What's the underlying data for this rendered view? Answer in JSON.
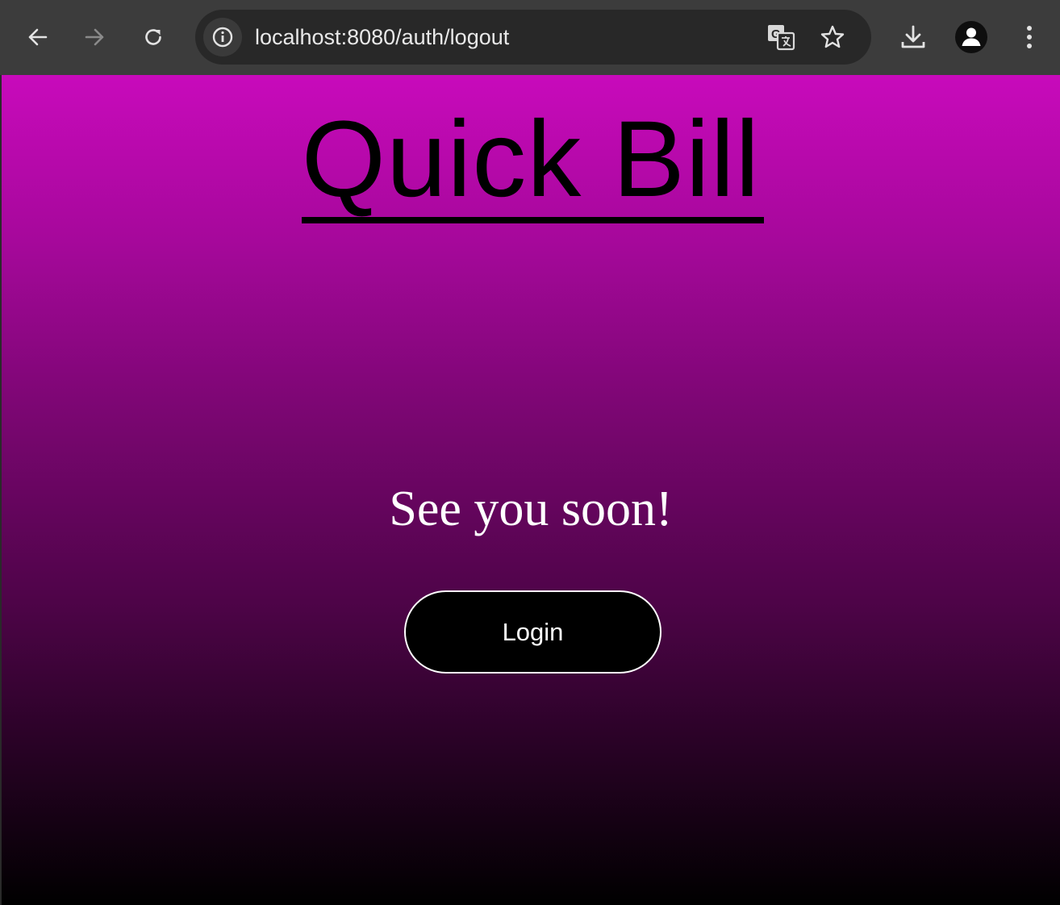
{
  "browser": {
    "url": "localhost:8080/auth/logout",
    "icons": {
      "back": "arrow-left-icon",
      "forward": "arrow-right-icon",
      "reload": "reload-icon",
      "site_info": "info-icon",
      "translate": "translate-icon",
      "bookmark": "star-icon",
      "download": "download-icon",
      "profile": "profile-icon",
      "menu": "kebab-menu-icon"
    }
  },
  "page": {
    "brand_title": "Quick Bill",
    "farewell_message": "See you soon!",
    "login_button_label": "Login"
  },
  "colors": {
    "gradient_top": "#c80abb",
    "gradient_bottom": "#000000",
    "toolbar": "#3c3c3c",
    "omnibox": "#282828"
  }
}
